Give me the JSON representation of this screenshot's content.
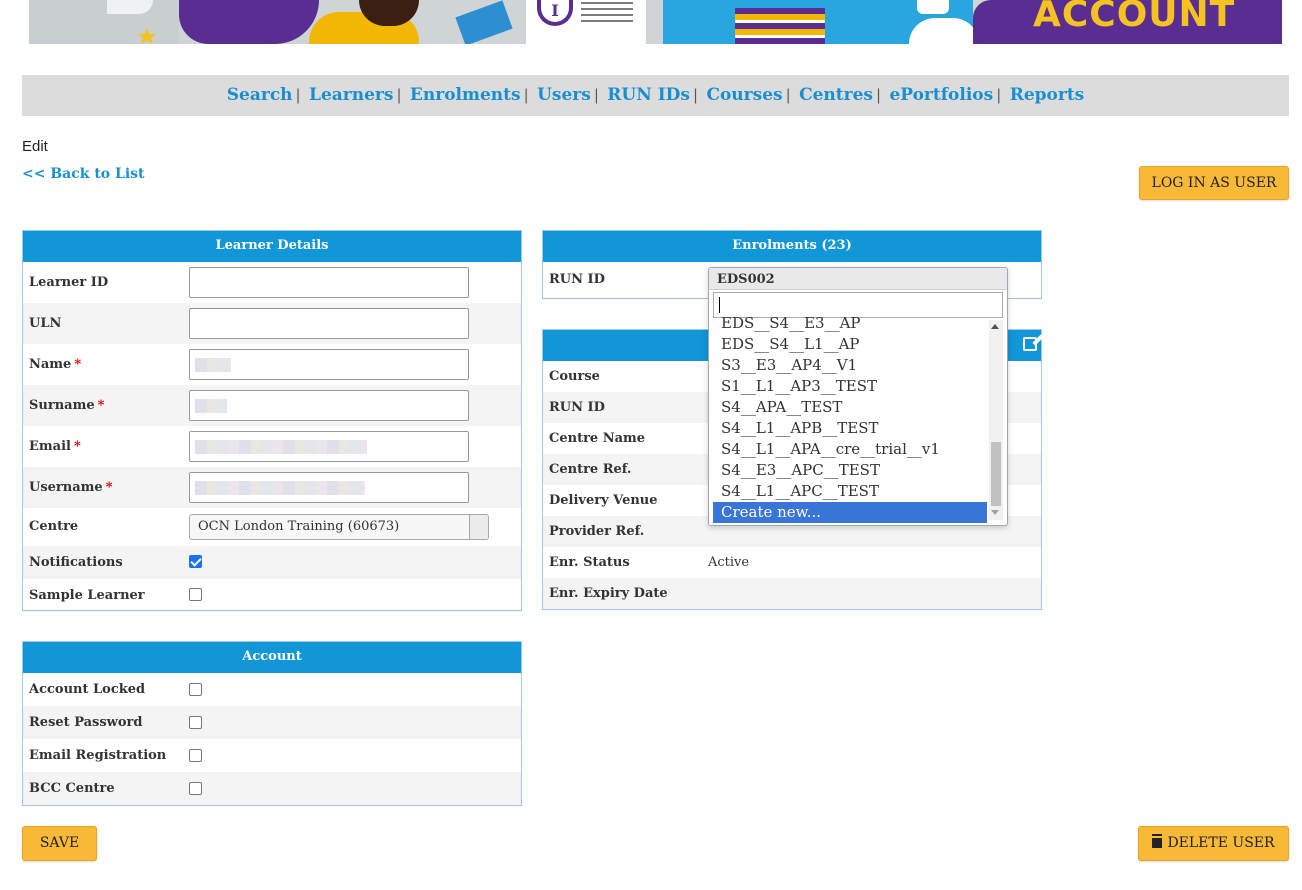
{
  "banner": {
    "text": "ACCOUNT",
    "info_glyph": "I"
  },
  "nav": {
    "items": [
      "Search",
      "Learners",
      "Enrolments",
      "Users",
      "RUN IDs",
      "Courses",
      "Centres",
      "ePortfolios",
      "Reports"
    ],
    "separator": "|"
  },
  "page": {
    "heading": "Edit",
    "back_link": "<< Back to List"
  },
  "buttons": {
    "login_as_user": "LOG IN AS USER",
    "save": "SAVE",
    "delete_user": "DELETE USER"
  },
  "learner_details": {
    "title": "Learner Details",
    "learner_id": {
      "label": "Learner ID",
      "value": ""
    },
    "uln": {
      "label": "ULN",
      "value": ""
    },
    "name": {
      "label": "Name",
      "required": "*"
    },
    "surname": {
      "label": "Surname",
      "required": "*"
    },
    "email": {
      "label": "Email",
      "required": "*"
    },
    "username": {
      "label": "Username",
      "required": "*"
    },
    "centre": {
      "label": "Centre",
      "value": "OCN London Training (60673)"
    },
    "notifications": {
      "label": "Notifications",
      "checked": true
    },
    "sample_learner": {
      "label": "Sample Learner",
      "checked": false
    }
  },
  "account": {
    "title": "Account",
    "account_locked": "Account Locked",
    "reset_password": "Reset Password",
    "email_registration": "Email Registration",
    "bcc_centre": "BCC Centre"
  },
  "enrolments": {
    "title": "Enrolments (23)",
    "run_id_label": "RUN ID",
    "dropdown": {
      "selected": "EDS002",
      "search_value": "",
      "options": [
        "EDS__S4__E3__AP",
        "EDS__S4__L1__AP",
        "S3__E3__AP4__V1",
        "S1__L1__AP3__TEST",
        "S4__APA__TEST",
        "S4__L1__APB__TEST",
        "S4__L1__APA__cre__trial__v1",
        "S4__E3__APC__TEST",
        "S4__L1__APC__TEST",
        "Create new..."
      ],
      "highlighted": "Create new..."
    }
  },
  "enrolment_details": {
    "course": "Course",
    "run_id": "RUN ID",
    "centre_name": "Centre Name",
    "centre_ref": "Centre Ref.",
    "delivery_venue": "Delivery Venue",
    "provider_ref": "Provider Ref.",
    "enr_status": {
      "label": "Enr. Status",
      "value": "Active"
    },
    "enr_expiry": "Enr. Expiry Date"
  },
  "colors": {
    "header_blue": "#1196d8",
    "link_blue": "#1a8fd0",
    "button_orange": "#f9b938",
    "highlight": "#3875d7"
  }
}
